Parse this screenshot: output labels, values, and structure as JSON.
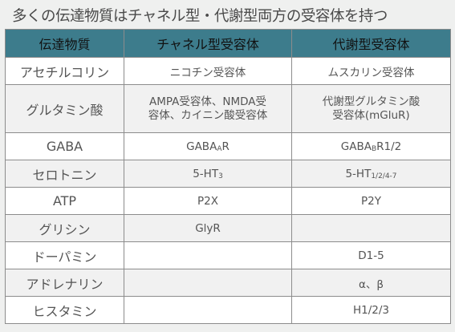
{
  "title": "多くの伝達物質はチャネル型・代謝型両方の受容体を持つ",
  "table": {
    "headers": [
      "伝達物質",
      "チャネル型受容体",
      "代謝型受容体"
    ],
    "rows": [
      {
        "substance": "アセチルコリン",
        "channel": {
          "main": "ニコチン受容体",
          "sub": ""
        },
        "metabotropic": {
          "main": "ムスカリン受容体",
          "sub": ""
        }
      },
      {
        "substance": "グルタミン酸",
        "channel": {
          "line1": "AMPA受容体、NMDA受",
          "line2": "容体、カイニン酸受容体"
        },
        "metabotropic": {
          "line1": "代謝型グルタミン酸",
          "line2": "受容体(mGluR)"
        }
      },
      {
        "substance": "GABA",
        "channel": {
          "main": "GABA",
          "sub": "A",
          "tail": "R"
        },
        "metabotropic": {
          "main": "GABA",
          "sub": "B",
          "tail": "R1/2"
        }
      },
      {
        "substance": "セロトニン",
        "channel": {
          "main": "5-HT",
          "sub": "3",
          "tail": ""
        },
        "metabotropic": {
          "main": "5-HT",
          "sub": "1/2/4-7",
          "tail": ""
        }
      },
      {
        "substance": "ATP",
        "channel": {
          "main": "P2X",
          "sub": "",
          "tail": ""
        },
        "metabotropic": {
          "main": "P2Y",
          "sub": "",
          "tail": ""
        }
      },
      {
        "substance": "グリシン",
        "channel": {
          "main": "GlyR",
          "sub": "",
          "tail": ""
        },
        "metabotropic": {
          "main": "",
          "sub": "",
          "tail": ""
        }
      },
      {
        "substance": "ドーパミン",
        "channel": {
          "main": "",
          "sub": "",
          "tail": ""
        },
        "metabotropic": {
          "main": "D1-5",
          "sub": "",
          "tail": ""
        }
      },
      {
        "substance": "アドレナリン",
        "channel": {
          "main": "",
          "sub": "",
          "tail": ""
        },
        "metabotropic": {
          "main": "α、β",
          "sub": "",
          "tail": ""
        }
      },
      {
        "substance": "ヒスタミン",
        "channel": {
          "main": "",
          "sub": "",
          "tail": ""
        },
        "metabotropic": {
          "main": "H1/2/3",
          "sub": "",
          "tail": ""
        }
      }
    ]
  },
  "colors": {
    "header_bg": "#3d7c8c",
    "page_bg": "#eff0ef",
    "border": "#8c8c8c"
  }
}
